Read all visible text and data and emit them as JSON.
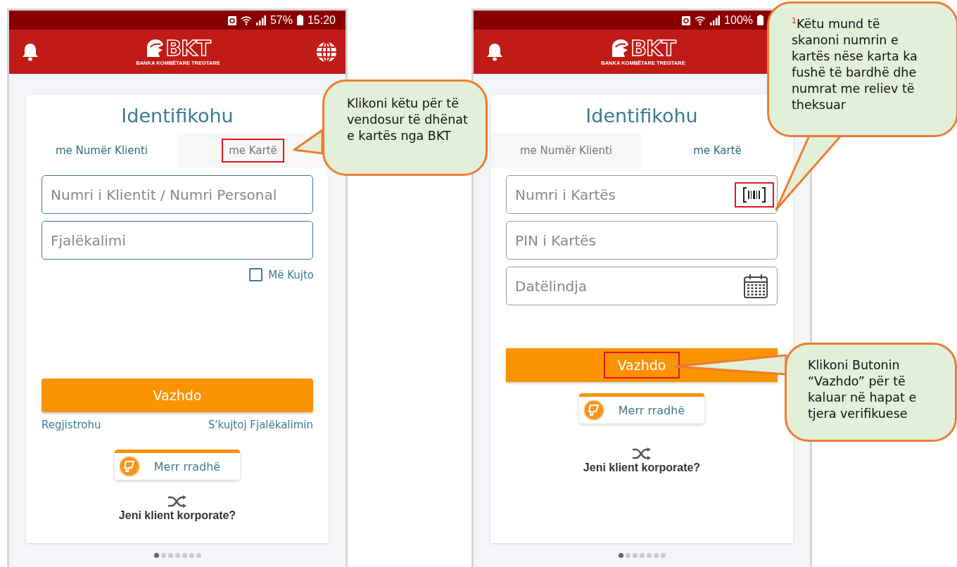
{
  "phones": [
    {
      "status_bar": {
        "battery": "57%",
        "time": "15:20"
      },
      "logo": {
        "mark": "BKT",
        "tagline": "BANKA KOMBËTARE TREGTARE",
        "globe": true
      },
      "title": "Identifikohu",
      "tabs": [
        {
          "label": "me Numër Klienti",
          "selected": true,
          "highlighted": false
        },
        {
          "label": "me Kartë",
          "selected": false,
          "highlighted": true
        }
      ],
      "fields": [
        {
          "placeholder": "Numri i Klientit / Numri Personal",
          "kind": "text"
        },
        {
          "placeholder": "Fjalëkalimi",
          "kind": "text"
        }
      ],
      "remember": {
        "label": "Më Kujto",
        "checked": false
      },
      "button": {
        "label": "Vazhdo",
        "highlighted": false
      },
      "links": [
        "Regjistrohu",
        "S'kujtoj Fjalëkalimin"
      ],
      "queue": "Merr rradhë",
      "corporate": "Jeni klient korporate?",
      "pages": [
        {
          "selected": true
        },
        {
          "selected": false
        },
        {
          "selected": false
        },
        {
          "selected": false
        },
        {
          "selected": false
        },
        {
          "selected": false
        },
        {
          "selected": false
        }
      ]
    },
    {
      "status_bar": {
        "battery": "100%"
      },
      "logo": {
        "mark": "BKT",
        "tagline": "BANKA KOMBËTARE TREGTARE",
        "globe": false
      },
      "title": "Identifikohu",
      "tabs": [
        {
          "label": "me Numër Klienti",
          "selected": false,
          "highlighted": false
        },
        {
          "label": "me Kartë",
          "selected": true,
          "highlighted": false
        }
      ],
      "fields": [
        {
          "placeholder": "Numri i Kartës",
          "kind": "barcode",
          "highlighted": true
        },
        {
          "placeholder": "PIN i Kartës",
          "kind": "text"
        },
        {
          "placeholder": "Datëlindja",
          "kind": "calendar",
          "highlighted": false
        }
      ],
      "button": {
        "label": "Vazhdo",
        "highlighted": true
      },
      "queue": "Merr rradhë",
      "corporate": "Jeni klient korporate?",
      "pages": [
        {
          "selected": true
        },
        {
          "selected": false
        },
        {
          "selected": false
        },
        {
          "selected": false
        },
        {
          "selected": false
        },
        {
          "selected": false
        },
        {
          "selected": false
        }
      ]
    }
  ],
  "callouts": [
    {
      "text": "Klikoni këtu për të vendosur të dhënat e kartës nga BKT"
    },
    {
      "text": "$^{1}$Këtu mund të skanoni numrin e kartës nëse karta ka fushë të bardhë dhe numrat me reliev të theksuar"
    },
    {
      "text": "Klikoni Butonin “Vazhdo” për të kaluar në hapat e tjera verifikuese"
    }
  ]
}
